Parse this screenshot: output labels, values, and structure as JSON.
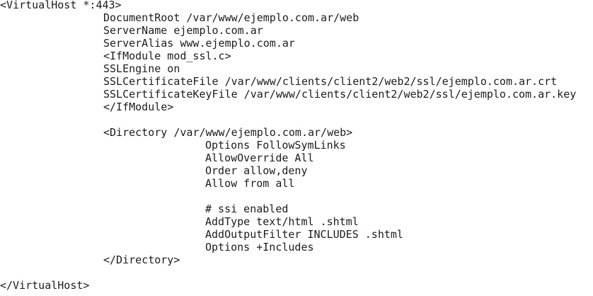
{
  "config_file": {
    "lines": [
      "<VirtualHost *:443>",
      "DocumentRoot /var/www/ejemplo.com.ar/web",
      "ServerName ejemplo.com.ar",
      "ServerAlias www.ejemplo.com.ar",
      "<IfModule mod_ssl.c>",
      "SSLEngine on",
      "SSLCertificateFile /var/www/clients/client2/web2/ssl/ejemplo.com.ar.crt",
      "SSLCertificateKeyFile /var/www/clients/client2/web2/ssl/ejemplo.com.ar.key",
      "</IfModule>",
      "",
      "<Directory /var/www/ejemplo.com.ar/web>",
      "Options FollowSymLinks",
      "AllowOverride All",
      "Order allow,deny",
      "Allow from all",
      "",
      "# ssi enabled",
      "AddType text/html .shtml",
      "AddOutputFilter INCLUDES .shtml",
      "Options +Includes",
      "</Directory>",
      "",
      "</VirtualHost>"
    ]
  },
  "colors": {
    "background": "#ffffff",
    "text": "#1c1c1c"
  }
}
